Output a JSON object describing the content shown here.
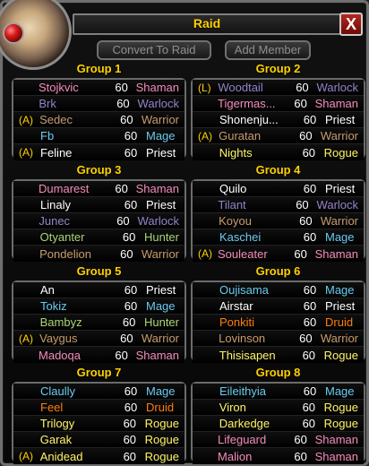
{
  "ui": {
    "title": "Raid",
    "close_label": "X",
    "convert_button": "Convert To Raid",
    "add_member_button": "Add Member"
  },
  "colors": {
    "Shaman": "#F58CBA",
    "Warlock": "#9482C9",
    "Warrior": "#C79C6E",
    "Mage": "#69CCF0",
    "Priest": "#FFFFFF",
    "Hunter": "#ABD473",
    "Rogue": "#FFF569",
    "Druid": "#FF7D0A"
  },
  "groups": [
    {
      "title": "Group 1",
      "members": [
        {
          "tag": "",
          "name": "Stojkvic",
          "level": "60",
          "class": "Shaman"
        },
        {
          "tag": "",
          "name": "Brk",
          "level": "60",
          "class": "Warlock"
        },
        {
          "tag": "(A)",
          "name": "Sedec",
          "level": "60",
          "class": "Warrior"
        },
        {
          "tag": "",
          "name": "Fb",
          "level": "60",
          "class": "Mage"
        },
        {
          "tag": "(A)",
          "name": "Feline",
          "level": "60",
          "class": "Priest"
        }
      ]
    },
    {
      "title": "Group 2",
      "members": [
        {
          "tag": "(L)",
          "name": "Woodtail",
          "level": "60",
          "class": "Warlock"
        },
        {
          "tag": "",
          "name": "Tigermas...",
          "level": "60",
          "class": "Shaman"
        },
        {
          "tag": "",
          "name": "Shonenju...",
          "level": "60",
          "class": "Priest"
        },
        {
          "tag": "(A)",
          "name": "Guratan",
          "level": "60",
          "class": "Warrior"
        },
        {
          "tag": "",
          "name": "Nights",
          "level": "60",
          "class": "Rogue"
        }
      ]
    },
    {
      "title": "Group 3",
      "members": [
        {
          "tag": "",
          "name": "Dumarest",
          "level": "60",
          "class": "Shaman"
        },
        {
          "tag": "",
          "name": "Linaly",
          "level": "60",
          "class": "Priest"
        },
        {
          "tag": "",
          "name": "Junec",
          "level": "60",
          "class": "Warlock"
        },
        {
          "tag": "",
          "name": "Otyanter",
          "level": "60",
          "class": "Hunter"
        },
        {
          "tag": "",
          "name": "Pondelion",
          "level": "60",
          "class": "Warrior"
        }
      ]
    },
    {
      "title": "Group 4",
      "members": [
        {
          "tag": "",
          "name": "Quilo",
          "level": "60",
          "class": "Priest"
        },
        {
          "tag": "",
          "name": "Tilant",
          "level": "60",
          "class": "Warlock"
        },
        {
          "tag": "",
          "name": "Koyou",
          "level": "60",
          "class": "Warrior"
        },
        {
          "tag": "",
          "name": "Kaschei",
          "level": "60",
          "class": "Mage"
        },
        {
          "tag": "(A)",
          "name": "Souleater",
          "level": "60",
          "class": "Shaman"
        }
      ]
    },
    {
      "title": "Group 5",
      "members": [
        {
          "tag": "",
          "name": "An",
          "level": "60",
          "class": "Priest"
        },
        {
          "tag": "",
          "name": "Tokiz",
          "level": "60",
          "class": "Mage"
        },
        {
          "tag": "",
          "name": "Bambyz",
          "level": "60",
          "class": "Hunter"
        },
        {
          "tag": "(A)",
          "name": "Vaygus",
          "level": "60",
          "class": "Warrior"
        },
        {
          "tag": "",
          "name": "Madoqa",
          "level": "60",
          "class": "Shaman"
        }
      ]
    },
    {
      "title": "Group 6",
      "members": [
        {
          "tag": "",
          "name": "Oujisama",
          "level": "60",
          "class": "Mage"
        },
        {
          "tag": "",
          "name": "Airstar",
          "level": "60",
          "class": "Priest"
        },
        {
          "tag": "",
          "name": "Ponkiti",
          "level": "60",
          "class": "Druid"
        },
        {
          "tag": "",
          "name": "Lovinson",
          "level": "60",
          "class": "Warrior"
        },
        {
          "tag": "",
          "name": "Thisisapen",
          "level": "60",
          "class": "Rogue"
        }
      ]
    },
    {
      "title": "Group 7",
      "members": [
        {
          "tag": "",
          "name": "Claully",
          "level": "60",
          "class": "Mage"
        },
        {
          "tag": "",
          "name": "Feel",
          "level": "60",
          "class": "Druid"
        },
        {
          "tag": "",
          "name": "Trilogy",
          "level": "60",
          "class": "Rogue"
        },
        {
          "tag": "",
          "name": "Garak",
          "level": "60",
          "class": "Rogue"
        },
        {
          "tag": "(A)",
          "name": "Anidead",
          "level": "60",
          "class": "Rogue"
        }
      ]
    },
    {
      "title": "Group 8",
      "members": [
        {
          "tag": "",
          "name": "Eileithyia",
          "level": "60",
          "class": "Mage"
        },
        {
          "tag": "",
          "name": "Viron",
          "level": "60",
          "class": "Rogue"
        },
        {
          "tag": "",
          "name": "Darkedge",
          "level": "60",
          "class": "Rogue"
        },
        {
          "tag": "",
          "name": "Lifeguard",
          "level": "60",
          "class": "Shaman"
        },
        {
          "tag": "",
          "name": "Malion",
          "level": "60",
          "class": "Shaman"
        }
      ]
    }
  ]
}
